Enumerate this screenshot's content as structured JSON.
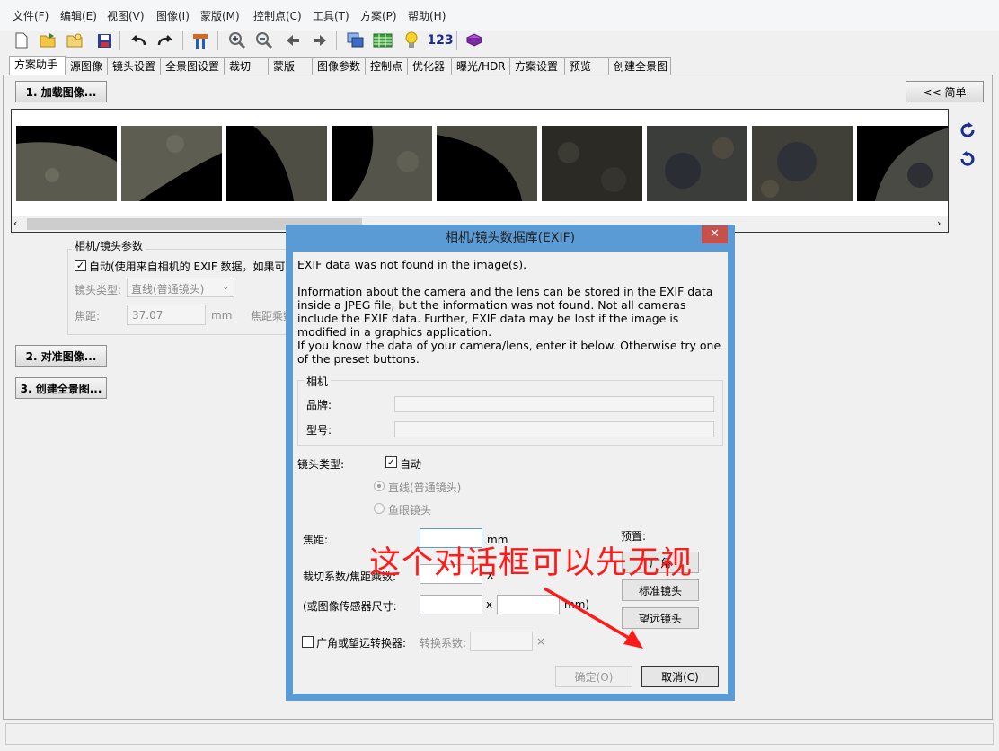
{
  "menu": [
    "文件(F)",
    "编辑(E)",
    "视图(V)",
    "图像(I)",
    "蒙版(M)",
    "控制点(C)",
    "工具(T)",
    "方案(P)",
    "帮助(H)"
  ],
  "toolbar": {
    "counter_label": "123"
  },
  "tabs": [
    "方案助手",
    "源图像",
    "镜头设置",
    "全景图设置",
    "裁切",
    "蒙版",
    "图像参数",
    "控制点",
    "优化器",
    "曝光/HDR",
    "方案设置",
    "预览",
    "创建全景图"
  ],
  "assistant": {
    "load_button": "1. 加载图像...",
    "simple_button": "<< 简单",
    "align_button": "2. 对准图像...",
    "create_button": "3. 创建全景图...",
    "camera_group": {
      "title": "相机/镜头参数",
      "auto_label": "自动(使用来自相机的 EXIF 数据，如果可用",
      "lens_type_label": "镜头类型:",
      "lens_type_value": "直线(普通镜头)",
      "focal_label": "焦距:",
      "focal_value": "37.07",
      "focal_unit": "mm",
      "crop_label": "焦距乘数"
    }
  },
  "dialog": {
    "title": "相机/镜头数据库(EXIF)",
    "close": "✕",
    "msg1": "EXIF data was not found in the image(s).",
    "msg2": "Information about the camera and the lens can be stored in the EXIF data inside a JPEG file, but the information was not found. Not all cameras include the EXIF data. Further, EXIF data may be lost if the image is modified in a graphics application.",
    "msg3": "If you know the data of your camera/lens, enter it below. Otherwise try one of the preset buttons.",
    "camera_group": "相机",
    "brand_label": "品牌:",
    "model_label": "型号:",
    "lens_type_label": "镜头类型:",
    "auto_label": "自动",
    "rectilinear_label": "直线(普通镜头)",
    "fisheye_label": "鱼眼镜头",
    "focal_label": "焦距:",
    "focal_unit": "mm",
    "crop_label": "裁切系数/焦距乘数:",
    "crop_x": "x",
    "sensor_label": "(或图像传感器尺寸:",
    "sensor_x": "x",
    "sensor_unit": "mm)",
    "preset_label": "预置:",
    "preset_wide": "广角",
    "preset_standard": "标准镜头",
    "preset_tele": "望远镜头",
    "converter_label": "广角或望远转换器:",
    "conversion_label": "转换系数:",
    "conversion_x": "×",
    "ok": "确定(O)",
    "cancel": "取消(C)"
  },
  "annotation": "这个对话框可以先无视"
}
